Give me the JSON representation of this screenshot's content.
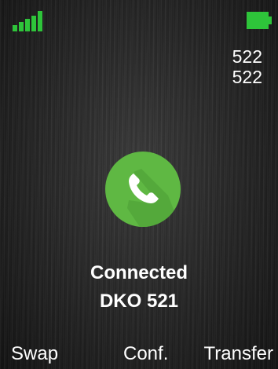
{
  "status_bar": {
    "signal_icon": "signal-strength-icon",
    "signal_level": 5,
    "battery_icon": "battery-full-icon",
    "battery_level_percent": 100,
    "accent_color": "#2ec43a"
  },
  "call": {
    "number_line_1": "522",
    "number_line_2": "522",
    "icon": "phone-handset-icon",
    "icon_color": "#5fb843",
    "state": "Connected",
    "remote_party": "DKO 521"
  },
  "softkeys": {
    "left": "Swap",
    "middle": "Conf.",
    "right": "Transfer"
  }
}
